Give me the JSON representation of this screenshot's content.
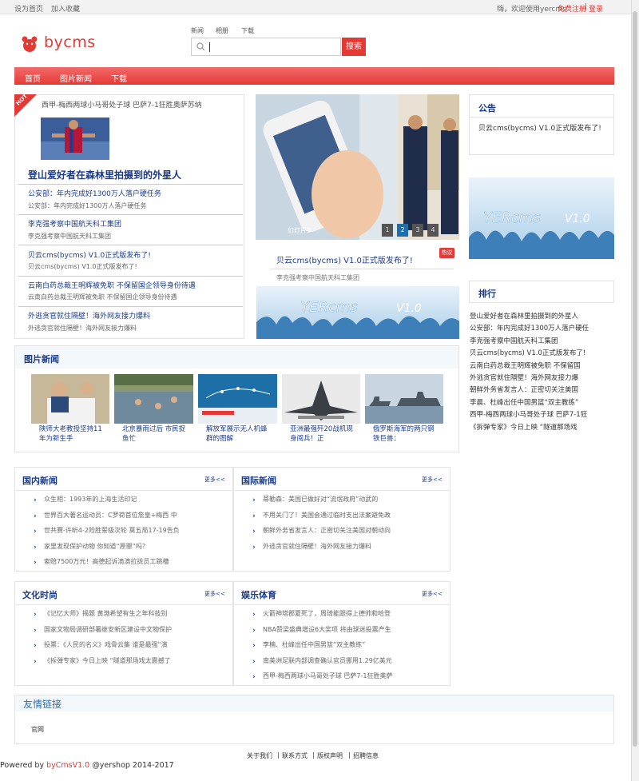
{
  "topbar": {
    "set_home": "设为首页",
    "add_fav": "加入收藏",
    "welcome": "嗨，欢迎使用yercms",
    "register": "免费注册",
    "sep": "|",
    "login": "登录"
  },
  "logo": {
    "text": "bycms"
  },
  "search": {
    "tabs": [
      "新闻",
      "相册",
      "下载"
    ],
    "button": "搜索",
    "value": ""
  },
  "nav": {
    "items": [
      "首页",
      "图片新闻",
      "下载"
    ]
  },
  "hot": {
    "badge": "HOT",
    "top_line": "西甲-梅西两球小马哥处子球 巴萨7-1狂胜奥萨苏纳",
    "headline": "登山爱好者在森林里拍摄到的外星人",
    "items": [
      {
        "title": "公安部：年内完成好1300万人落户硬任务",
        "summary": "公安部：年内完成好1300万人落户硬任务"
      },
      {
        "title": "李克强考察中国航天科工集团",
        "summary": "李克强考察中国航天科工集团"
      },
      {
        "title": "贝云cms(bycms) V1.0正式版发布了!",
        "summary": "贝云cms(bycms) V1.0正式版发布了!"
      },
      {
        "title": "云南白药总裁王明辉被免职 不保留国企领导身份待遇",
        "summary": "云南白药总裁王明辉被免职 不保留国企领导身份待遇"
      },
      {
        "title": "外逃贪官就住隔壁！海外网友接力爆料",
        "summary": "外逃贪官就住隔壁！海外网友接力爆料"
      }
    ]
  },
  "slider": {
    "caption": "幻灯片3",
    "pages": [
      "1",
      "2",
      "3",
      "4"
    ],
    "active": "2",
    "title": "贝云cms(bycms) V1.0正式版发布了!",
    "tag": "热议",
    "subtitle": "李克强考察中国航天科工集团",
    "banner_text": "YERCMS V1.0"
  },
  "notice": {
    "title": "公告",
    "text": "贝云cms(bycms) V1.0正式版发布了!"
  },
  "ranking": {
    "title": "排行",
    "items": [
      "登山爱好者在森林里拍摄到的外星人",
      "公安部：年内完成好1300万人落户硬任",
      "李克强考察中国航天科工集团",
      "贝云cms(bycms) V1.0正式版发布了!",
      "云南白药总裁王明辉被免职 不保留国",
      "外逃贪官就住隔壁！海外网友接力爆",
      "朝鲜外务省发言人：正密切关注美国",
      "李晨、杜峰出任中国男篮“双主教练”",
      "西甲-梅西两球小马哥处子球 巴萨7-1狂",
      "《拆弹专家》今日上映 “隧道那场戏"
    ]
  },
  "photo_news": {
    "title": "图片新闻",
    "captions": [
      "陕师大老教授坚持11年为新生手",
      "北京暴雨过后 市民捉鱼忙",
      "解放军展示无人机蜂群的图解",
      "亚洲最强歼20战机现身阅兵！正",
      "俄罗斯海军的两只钢铁巨兽："
    ]
  },
  "domestic": {
    "title": "国内新闻",
    "more": "更多<<",
    "items": [
      "众生相：1993年的上海生活印记",
      "世界百大著名运动员：C罗荷首位詹皇+梅西 中",
      "世共赛-许昕4-2险胜誓级次轮 莫五局17-19告负",
      "家里发现保护动物 你知道“原罪”吗？",
      "索赔7500万元！高德起诉滴滴拉拢员工跳槽"
    ]
  },
  "international": {
    "title": "国际新闻",
    "more": "更多<<",
    "items": [
      "蒂勒森：美国已做好对“流氓政府”动武的",
      "不用关门了！美国会通过临时支出法案避免政",
      "朝鲜外务省发言人：正密切关注美国对朝动向",
      "外逃贪官就住隔壁！海外网友接力爆料"
    ]
  },
  "culture": {
    "title": "文化时尚",
    "more": "更多<<",
    "items": [
      "《记忆大师》揭题 黄渤希望有生之年科技别",
      "国家文物局调研部署继安新区建设中文物保护",
      "投票：《人民的名义》戏骨云集 谁是最强“演",
      "《拆弹专家》今日上映 “隧道那场戏太震撼了"
    ]
  },
  "sports": {
    "title": "娱乐体育",
    "more": "更多<<",
    "items": [
      "火箭神塔郡夏死了，周琦能跟得上德帅和哈登",
      "NBA赞梁盛典增设6大奖项 将由球迷投票产生",
      "李楠、杜峰出任中国男篮“双主教练”",
      "南美洲足联内部调查确认官员挪用1.29亿美元",
      "西甲-梅西两球小马哥处子球 巴萨7-1狂胜奥萨"
    ]
  },
  "links": {
    "title": "友情链接",
    "items": [
      "官网"
    ]
  },
  "footer": {
    "links": [
      "关于我们",
      "联系方式",
      "版权声明",
      "招聘信息"
    ],
    "sep": "|",
    "powered_prefix": "Powered by ",
    "brand": "byCmsV1.0",
    "suffix": " @yershop 2014-2017"
  },
  "colors": {
    "accent": "#e53935",
    "link": "#1a3b8a",
    "active_page": "#1e6ea8"
  }
}
